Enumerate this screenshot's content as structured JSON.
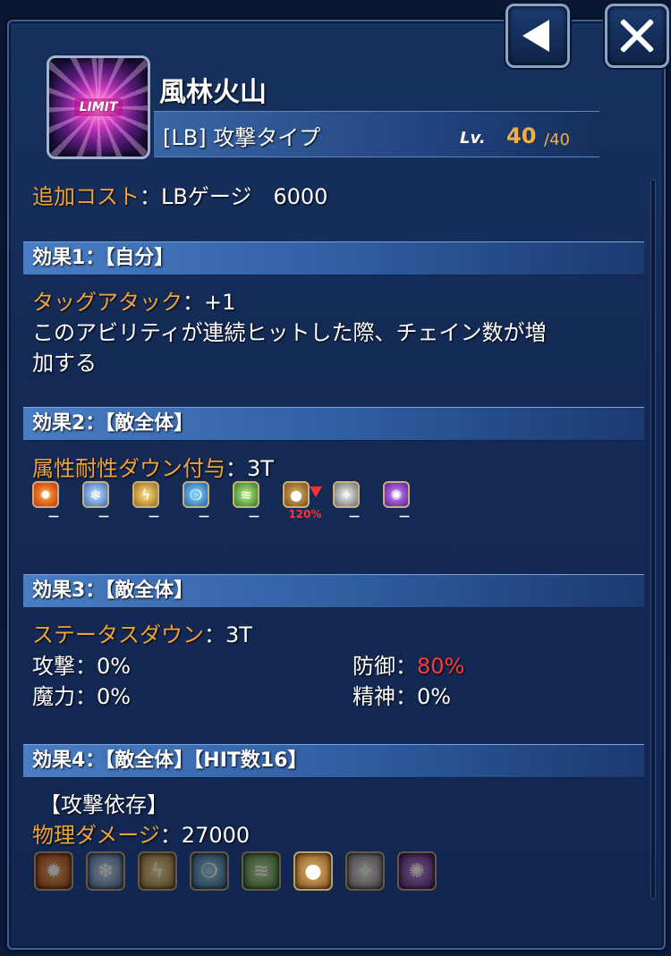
{
  "header": {
    "back_icon": "back-arrow-icon",
    "close_icon": "close-icon"
  },
  "ability": {
    "icon_text": "LIMIT",
    "name": "風林火山",
    "type": "[LB] 攻撃タイプ",
    "lv_label": "Lv.",
    "lv_current": "40",
    "lv_max": "/40"
  },
  "cost": {
    "label": "追加コスト",
    "value": "：LBゲージ　6000"
  },
  "effects": [
    {
      "header": "効果1：【自分】",
      "name": "タッグアタック",
      "value": "：+1",
      "desc_line1": "このアビリティが連続ヒットした際、チェイン数が増",
      "desc_line2": "加する"
    },
    {
      "header": "効果2：【敵全体】",
      "name": "属性耐性ダウン付与",
      "value": "：3T",
      "elements": [
        {
          "icon": "fire-icon",
          "value": "－"
        },
        {
          "icon": "ice-icon",
          "value": "－"
        },
        {
          "icon": "thunder-icon",
          "value": "－"
        },
        {
          "icon": "water-icon",
          "value": "－"
        },
        {
          "icon": "wind-icon",
          "value": "－"
        },
        {
          "icon": "earth-icon",
          "value": "120%"
        },
        {
          "icon": "light-icon",
          "value": "－"
        },
        {
          "icon": "dark-icon",
          "value": "－"
        }
      ]
    },
    {
      "header": "効果3：【敵全体】",
      "name": "ステータスダウン",
      "value": "：3T",
      "stats": {
        "atk_label": "攻撃",
        "atk_value": "：0%",
        "def_label": "防御",
        "def_sep": "：",
        "def_value": "80%",
        "mag_label": "魔力",
        "mag_value": "：0%",
        "spr_label": "精神",
        "spr_value": "：0%"
      }
    },
    {
      "header": "効果4：【敵全体】【HIT数16】",
      "sub": "【攻撃依存】",
      "name": "物理ダメージ",
      "value": "：27000",
      "elements": [
        "fire-icon",
        "ice-icon",
        "thunder-icon",
        "water-icon",
        "wind-icon",
        "earth-icon",
        "light-icon",
        "dark-icon"
      ]
    }
  ],
  "colors": {
    "accent_orange": "#f0a338",
    "highlight_red": "#ff3a3a",
    "lv_gold": "#f0b040"
  }
}
